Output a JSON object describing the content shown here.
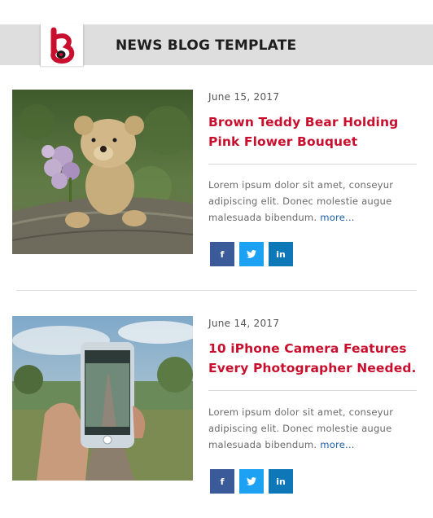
{
  "header": {
    "title": "NEWS BLOG TEMPLATE",
    "logo_icon": "headphone-b-logo",
    "accent_color": "#c8102e"
  },
  "posts": [
    {
      "date": "June 15, 2017",
      "title_line1": "Brown Teddy Bear Holding",
      "title_line2": "Pink Flower Bouquet",
      "excerpt_line1": "Lorem ipsum dolor sit amet, conseyur",
      "excerpt_line2": "adipiscing elit. Donec molestie augue",
      "excerpt_line3": "malesuada bibendum.",
      "more_label": "more...",
      "image_icon": "teddy-bear-photo",
      "social": {
        "facebook": "f",
        "twitter": "t",
        "linkedin": "in"
      }
    },
    {
      "date": "June 14, 2017",
      "title_line1": "10 iPhone Camera Features",
      "title_line2": "Every Photographer Needed.",
      "excerpt_line1": "Lorem ipsum dolor sit amet, conseyur",
      "excerpt_line2": "adipiscing elit. Donec molestie augue",
      "excerpt_line3": "malesuada bibendum.",
      "more_label": "more...",
      "image_icon": "iphone-camera-photo",
      "social": {
        "facebook": "f",
        "twitter": "t",
        "linkedin": "in"
      }
    }
  ]
}
